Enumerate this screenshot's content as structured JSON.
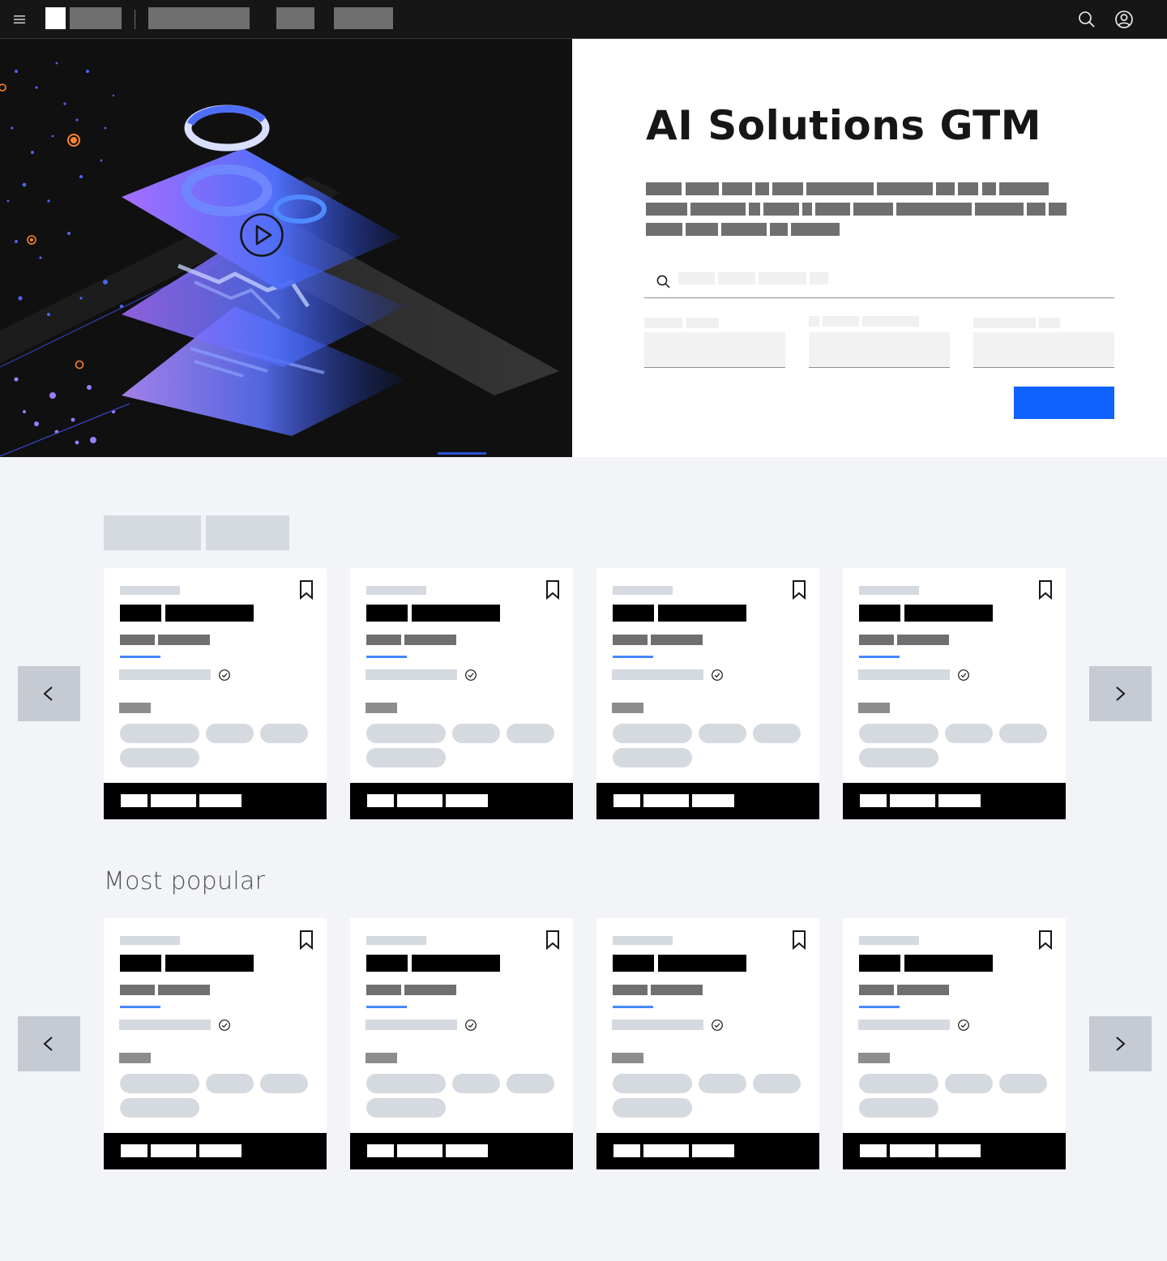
{
  "hero": {
    "title": "AI Solutions GTM",
    "play_icon": "play-circle-icon"
  },
  "nav": {
    "menu_icon": "hamburger-menu-icon",
    "search_icon": "search-icon",
    "user_icon": "user-avatar-icon"
  },
  "search": {
    "icon": "search-icon"
  },
  "featured": {
    "prev_icon": "chevron-left-icon",
    "next_icon": "chevron-right-icon",
    "cards": 4
  },
  "popular": {
    "title": "Most popular",
    "prev_icon": "chevron-left-icon",
    "next_icon": "chevron-right-icon",
    "cards": 4
  },
  "card_icons": {
    "bookmark": "bookmark-icon",
    "verified": "checkmark-outline-icon"
  },
  "colors": {
    "nav_bg": "#161616",
    "cta": "#0f62fe",
    "accent_line": "#4589ff",
    "page_bg": "#f2f4f8",
    "tag_bg": "#d5d9e0",
    "card_footer": "#000000"
  }
}
